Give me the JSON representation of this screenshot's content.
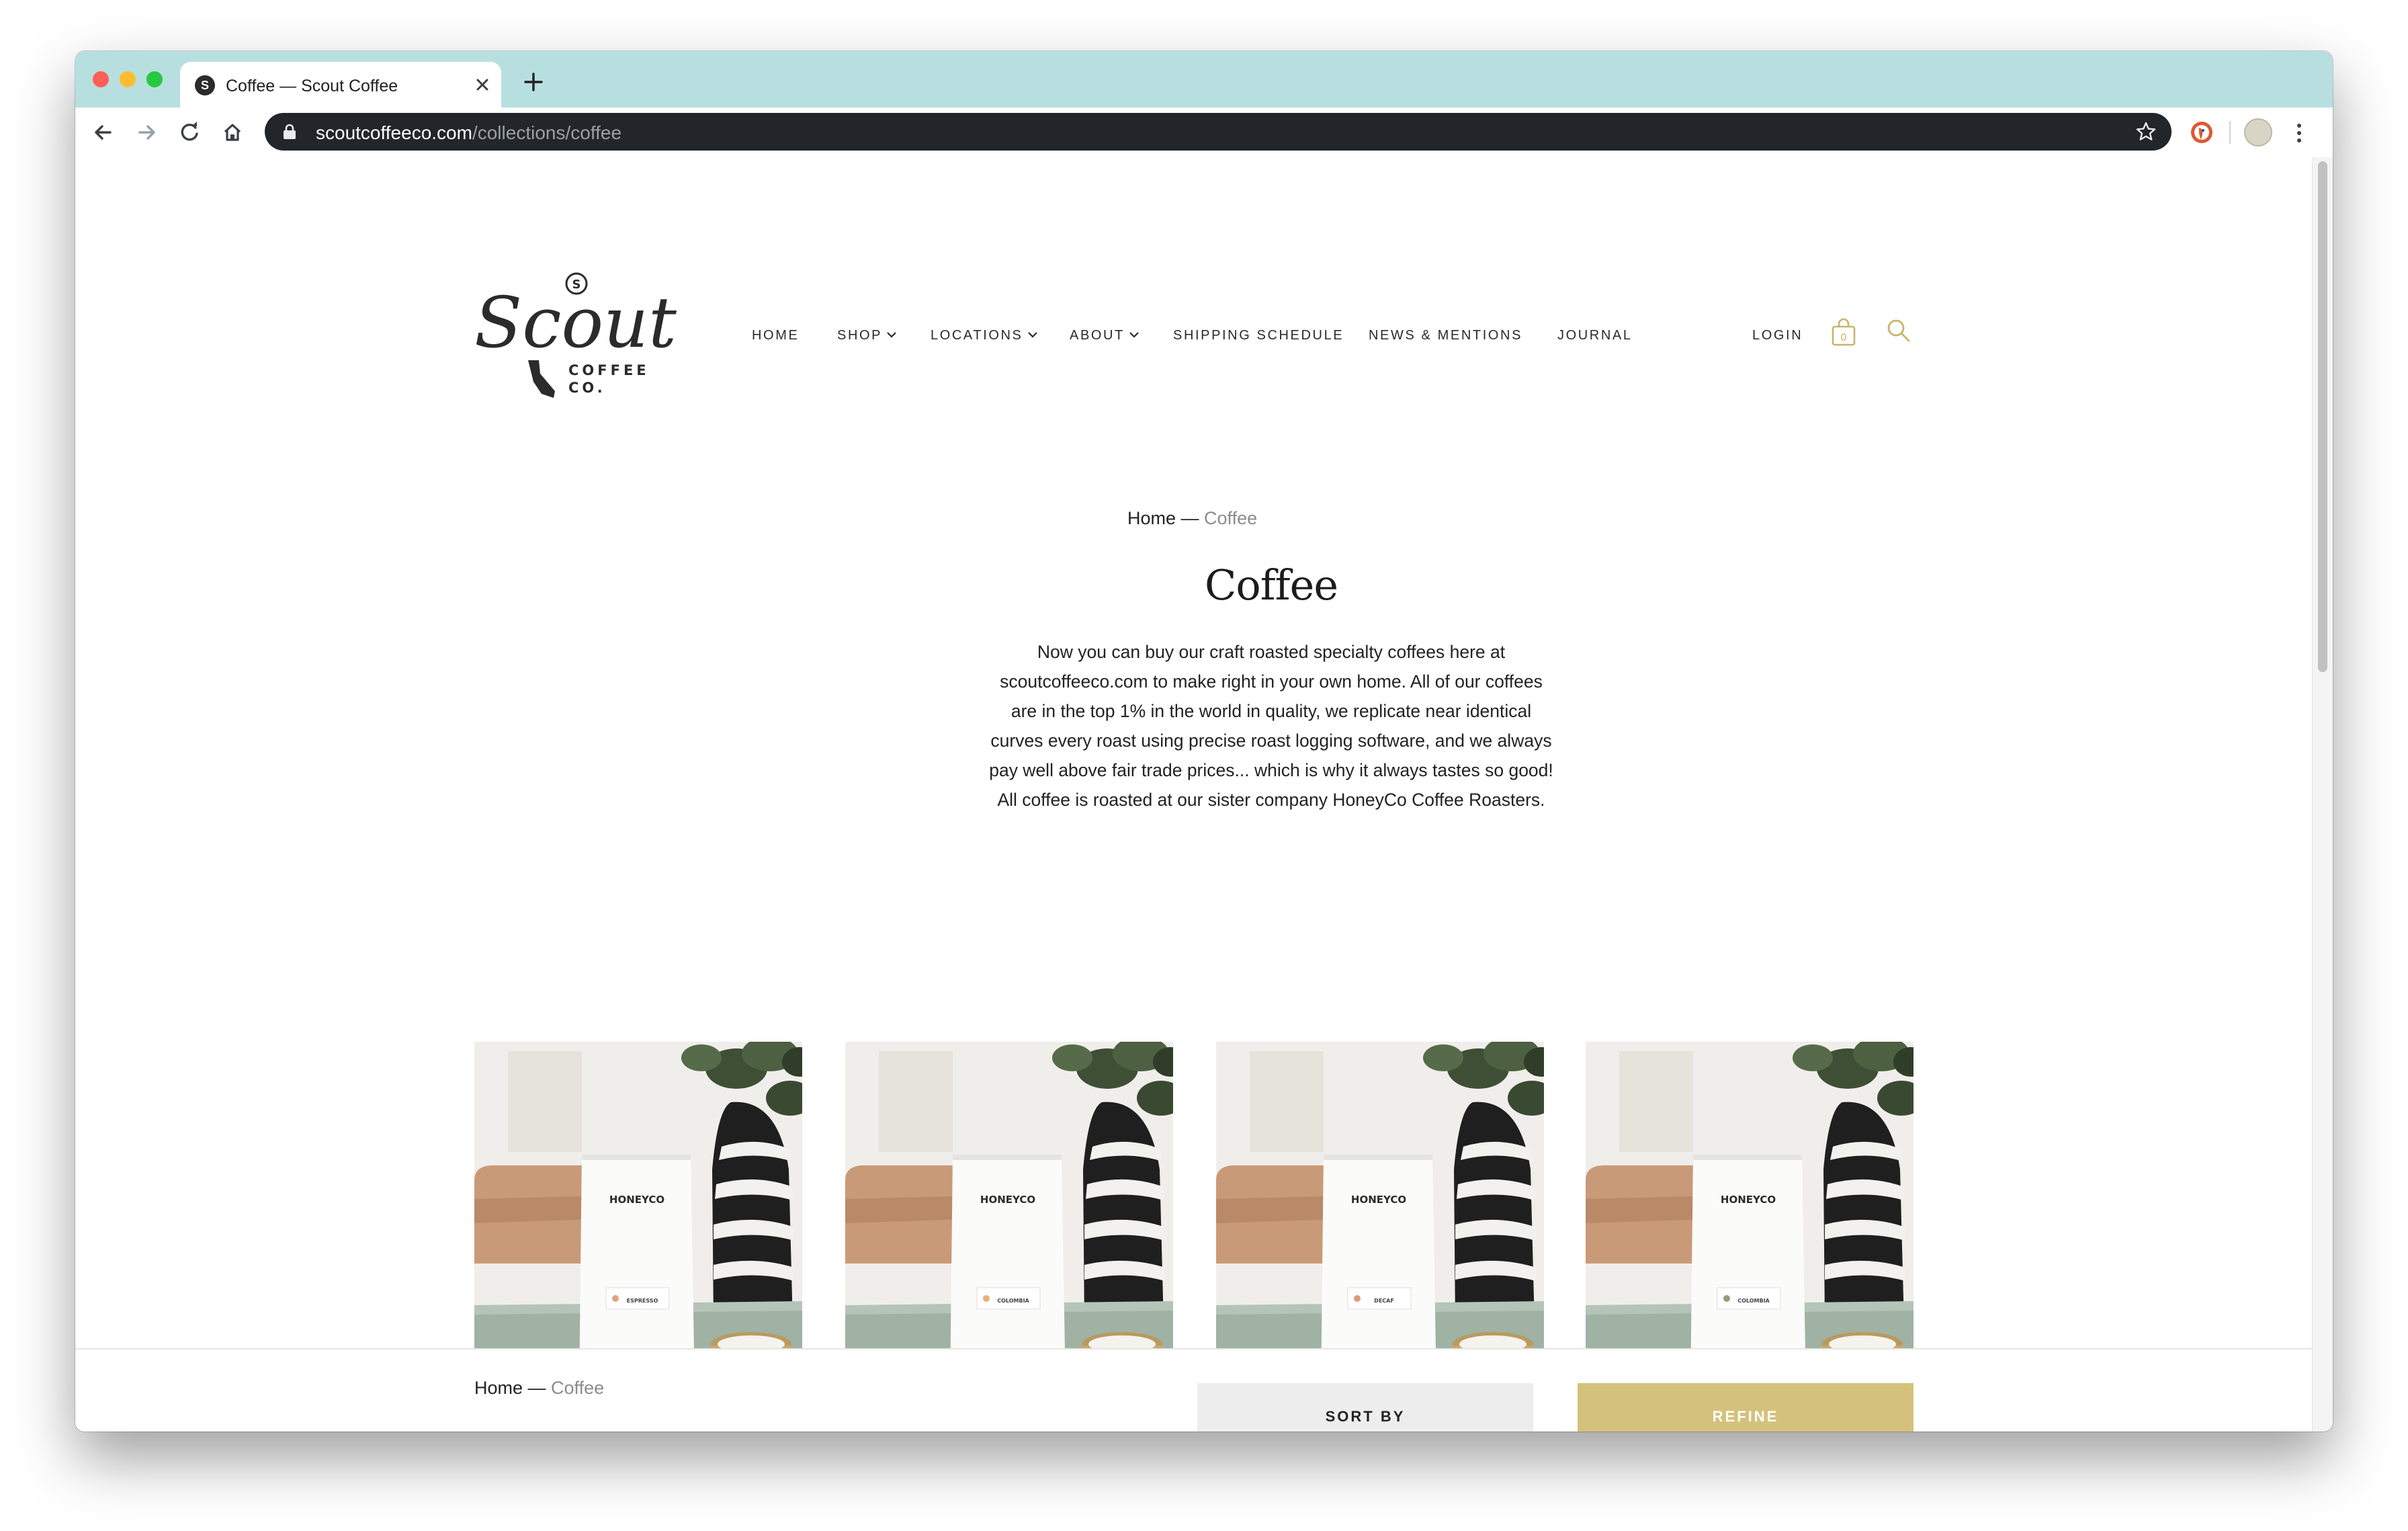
{
  "browser": {
    "tab_title": "Coffee — Scout Coffee",
    "tab_favicon_letter": "S",
    "url_host": "scoutcoffeeco.com",
    "url_path": "/collections/coffee"
  },
  "site": {
    "logo_script": "Scout",
    "logo_sub_1": "COFFEE",
    "logo_sub_2": "CO.",
    "logo_badge": "S",
    "nav": {
      "home": "HOME",
      "shop": "SHOP",
      "locations": "LOCATIONS",
      "about": "ABOUT",
      "shipping": "SHIPPING SCHEDULE",
      "news": "NEWS & MENTIONS",
      "journal": "JOURNAL",
      "login": "LOGIN",
      "cart_count": "0"
    },
    "accent_color": "#d4c27c"
  },
  "main": {
    "breadcrumb_home": "Home",
    "breadcrumb_sep": " — ",
    "breadcrumb_current": "Coffee",
    "title": "Coffee",
    "intro_lines": [
      "Now you can buy our craft roasted specialty coffees here at",
      "scoutcoffeeco.com to make right in your own home.  All of our coffees",
      "are in the top 1% in the world in quality, we replicate near identical",
      "curves every roast using precise roast logging software, and we always",
      "pay well above fair trade prices... which is why it always tastes so good!",
      "All coffee is roasted at our sister company HoneyCo Coffee Roasters."
    ],
    "products": [
      {
        "brand": "HONEYCO",
        "label": "ESPRESSO",
        "dot_color": "#e2a27c"
      },
      {
        "brand": "HONEYCO",
        "label": "COLOMBIA",
        "dot_color": "#e6b078"
      },
      {
        "brand": "HONEYCO",
        "label": "DECAF",
        "dot_color": "#e09a78"
      },
      {
        "brand": "HONEYCO",
        "label": "COLOMBIA",
        "dot_color": "#8ea07a"
      }
    ]
  },
  "sticky": {
    "breadcrumb_home": "Home",
    "breadcrumb_sep": " — ",
    "breadcrumb_current": "Coffee",
    "sort_label": "SORT BY",
    "refine_label": "REFINE"
  }
}
